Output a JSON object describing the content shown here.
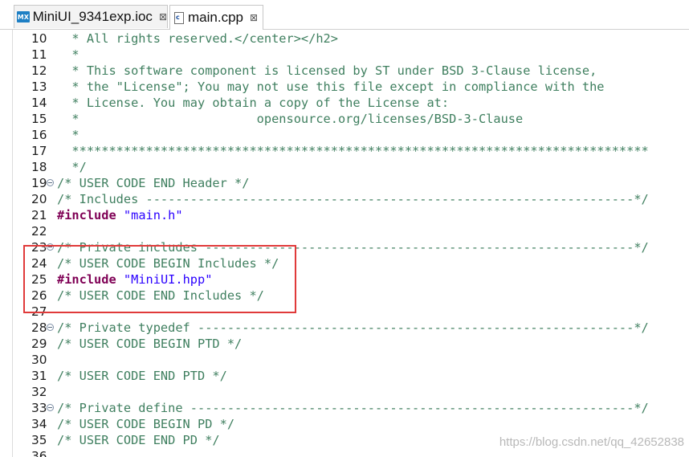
{
  "tabs": [
    {
      "label": "MiniUI_9341exp.ioc",
      "icon": "MX",
      "close": "⊠",
      "active": false
    },
    {
      "label": "main.cpp",
      "icon": "c",
      "close": "⊠",
      "active": true
    }
  ],
  "lines": [
    {
      "num": "10",
      "fold": false,
      "segs": [
        {
          "t": "  * All rights reserved.</center></h2>",
          "c": "comment"
        }
      ]
    },
    {
      "num": "11",
      "fold": false,
      "segs": [
        {
          "t": "  *",
          "c": "comment"
        }
      ]
    },
    {
      "num": "12",
      "fold": false,
      "segs": [
        {
          "t": "  * This software component is licensed by ST under BSD 3-Clause license,",
          "c": "comment"
        }
      ]
    },
    {
      "num": "13",
      "fold": false,
      "segs": [
        {
          "t": "  * the \"License\"; You may not use this file except in compliance with the",
          "c": "comment"
        }
      ]
    },
    {
      "num": "14",
      "fold": false,
      "segs": [
        {
          "t": "  * License. You may obtain a copy of the License at:",
          "c": "comment"
        }
      ]
    },
    {
      "num": "15",
      "fold": false,
      "segs": [
        {
          "t": "  *                        opensource.org/licenses/BSD-3-Clause",
          "c": "comment"
        }
      ]
    },
    {
      "num": "16",
      "fold": false,
      "segs": [
        {
          "t": "  *",
          "c": "comment"
        }
      ]
    },
    {
      "num": "17",
      "fold": false,
      "segs": [
        {
          "t": "  ******************************************************************************",
          "c": "comment"
        }
      ]
    },
    {
      "num": "18",
      "fold": false,
      "segs": [
        {
          "t": "  */",
          "c": "comment"
        }
      ]
    },
    {
      "num": "19",
      "fold": true,
      "segs": [
        {
          "t": "/* USER CODE END Header */",
          "c": "comment"
        }
      ]
    },
    {
      "num": "20",
      "fold": false,
      "segs": [
        {
          "t": "/* Includes ------------------------------------------------------------------*/",
          "c": "comment"
        }
      ]
    },
    {
      "num": "21",
      "fold": false,
      "segs": [
        {
          "t": "#include",
          "c": "kw"
        },
        {
          "t": " ",
          "c": "plain"
        },
        {
          "t": "\"main.h\"",
          "c": "str"
        }
      ]
    },
    {
      "num": "22",
      "fold": false,
      "segs": []
    },
    {
      "num": "23",
      "fold": true,
      "segs": [
        {
          "t": "/* Private includes ----------------------------------------------------------*/",
          "c": "comment"
        }
      ]
    },
    {
      "num": "24",
      "fold": false,
      "segs": [
        {
          "t": "/* USER CODE BEGIN Includes */",
          "c": "comment"
        }
      ]
    },
    {
      "num": "25",
      "fold": false,
      "segs": [
        {
          "t": "#include",
          "c": "kw"
        },
        {
          "t": " ",
          "c": "plain"
        },
        {
          "t": "\"MiniUI.hpp\"",
          "c": "str"
        }
      ]
    },
    {
      "num": "26",
      "fold": false,
      "segs": [
        {
          "t": "/* USER CODE END Includes */",
          "c": "comment"
        }
      ]
    },
    {
      "num": "27",
      "fold": false,
      "segs": []
    },
    {
      "num": "28",
      "fold": true,
      "segs": [
        {
          "t": "/* Private typedef -----------------------------------------------------------*/",
          "c": "comment"
        }
      ]
    },
    {
      "num": "29",
      "fold": false,
      "segs": [
        {
          "t": "/* USER CODE BEGIN PTD */",
          "c": "comment"
        }
      ]
    },
    {
      "num": "30",
      "fold": false,
      "segs": []
    },
    {
      "num": "31",
      "fold": false,
      "segs": [
        {
          "t": "/* USER CODE END PTD */",
          "c": "comment"
        }
      ]
    },
    {
      "num": "32",
      "fold": false,
      "segs": []
    },
    {
      "num": "33",
      "fold": true,
      "segs": [
        {
          "t": "/* Private define ------------------------------------------------------------*/",
          "c": "comment"
        }
      ]
    },
    {
      "num": "34",
      "fold": false,
      "segs": [
        {
          "t": "/* USER CODE BEGIN PD */",
          "c": "comment"
        }
      ]
    },
    {
      "num": "35",
      "fold": false,
      "segs": [
        {
          "t": "/* USER CODE END PD */",
          "c": "comment"
        }
      ]
    },
    {
      "num": "36",
      "fold": false,
      "segs": []
    }
  ],
  "watermark": "https://blog.csdn.net/qq_42652838",
  "colors": {
    "comment": "#3f7f5f",
    "keyword": "#7f0055",
    "string": "#2a00ff",
    "highlight_box": "#e03a3a"
  }
}
